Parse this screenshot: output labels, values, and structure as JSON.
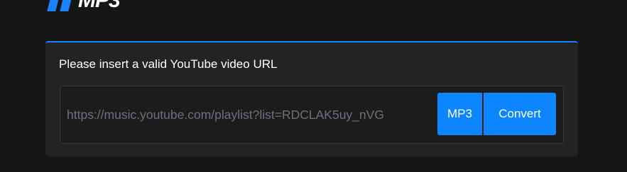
{
  "logo": {
    "text": "MP3"
  },
  "form": {
    "title": "Please insert a valid YouTube video URL",
    "url_value": "https://music.youtube.com/playlist?list=RDCLAK5uy_nVG",
    "format_button_label": "MP3",
    "convert_button_label": "Convert"
  },
  "colors": {
    "accent": "#0d85ff",
    "background": "#161616",
    "card": "#232323",
    "input_text": "#6f6f80"
  }
}
